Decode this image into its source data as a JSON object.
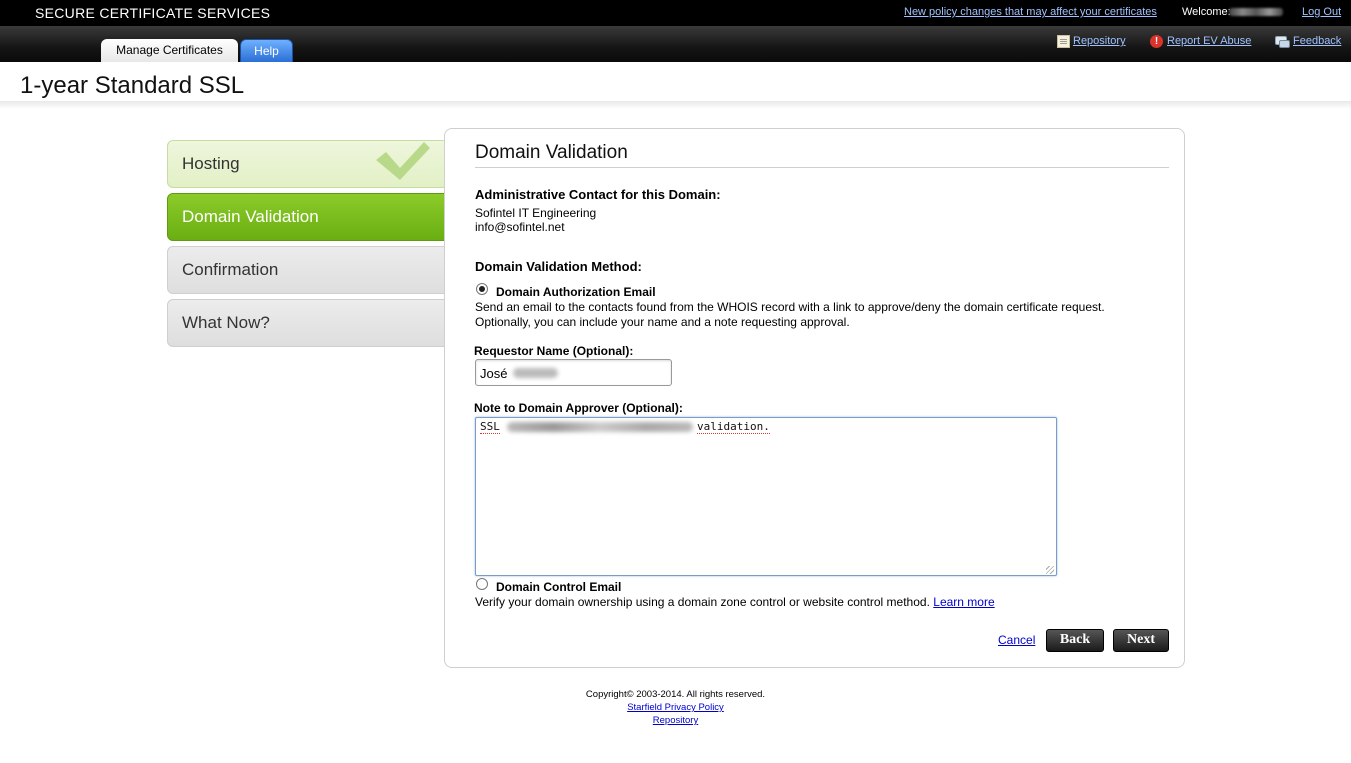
{
  "topbar": {
    "brand": "SECURE CERTIFICATE SERVICES",
    "policy_link": "New policy changes that may affect your certificates",
    "welcome_label": "Welcome:",
    "logout": "Log Out"
  },
  "nav": {
    "tabs": [
      {
        "label": "Manage Certificates"
      },
      {
        "label": "Help"
      }
    ],
    "links": [
      {
        "label": "Repository",
        "icon": "document-icon"
      },
      {
        "label": "Report EV Abuse",
        "icon": "alert-icon"
      },
      {
        "label": "Feedback",
        "icon": "feedback-icon"
      }
    ]
  },
  "page": {
    "title": "1-year Standard SSL"
  },
  "steps": [
    {
      "label": "Hosting",
      "state": "completed"
    },
    {
      "label": "Domain Validation",
      "state": "active"
    },
    {
      "label": "Confirmation",
      "state": "pending"
    },
    {
      "label": "What Now?",
      "state": "pending"
    }
  ],
  "panel": {
    "title": "Domain Validation",
    "admin_contact_label": "Administrative Contact for this Domain:",
    "admin_org": "Sofintel IT Engineering",
    "admin_email": "info@sofintel.net",
    "method_label": "Domain Validation Method:",
    "option_auth_email": {
      "label": "Domain Authorization Email",
      "description_1": "Send an email to the contacts found from the WHOIS record with a link to approve/deny the domain certificate request.",
      "description_2": "Optionally, you can include your name and a note requesting approval.",
      "selected": true
    },
    "requestor_label": "Requestor Name (Optional):",
    "requestor_value": "José",
    "note_label": "Note to Domain Approver (Optional):",
    "note_value_start": "SSL",
    "note_value_end": "validation.",
    "option_control_email": {
      "label": "Domain Control Email",
      "description": "Verify your domain ownership using a domain zone control or website control method.",
      "learn_more": "Learn more",
      "selected": false
    },
    "cancel": "Cancel",
    "back": "Back",
    "next": "Next"
  },
  "footer": {
    "copyright": "Copyright© 2003-2014. All rights reserved.",
    "privacy": "Starfield Privacy Policy",
    "repository": "Repository"
  }
}
